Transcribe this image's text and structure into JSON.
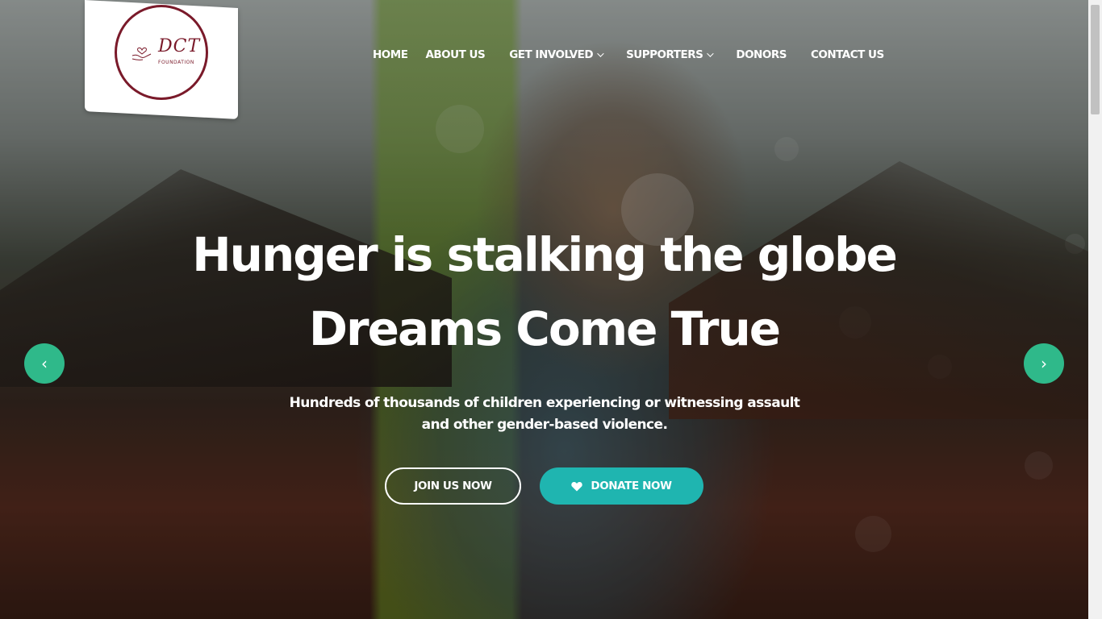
{
  "brand": {
    "logo_text": "DCT",
    "logo_subtext": "FOUNDATION",
    "color": "#7a1a2a"
  },
  "nav": {
    "items": [
      {
        "label": "HOME",
        "dropdown": false
      },
      {
        "label": "ABOUT US",
        "dropdown": false
      },
      {
        "label": "GET INVOLVED",
        "dropdown": true
      },
      {
        "label": "SUPPORTERS",
        "dropdown": true
      },
      {
        "label": "DONORS",
        "dropdown": false
      },
      {
        "label": "CONTACT US",
        "dropdown": false
      }
    ]
  },
  "hero": {
    "headline_line1": "Hunger is stalking the globe",
    "headline_line2": "Dreams Come True",
    "subtext": "Hundreds of thousands of children experiencing or witnessing assault and other gender-based violence.",
    "join_label": "JOIN US NOW",
    "donate_label": "DONATE NOW",
    "donate_icon": "heart-icon",
    "accent_color": "#1fb5b0",
    "arrow_color": "#2fb98a"
  },
  "carousel": {
    "prev_icon": "chevron-left-icon",
    "next_icon": "chevron-right-icon",
    "prev_glyph": "‹",
    "next_glyph": "›"
  }
}
